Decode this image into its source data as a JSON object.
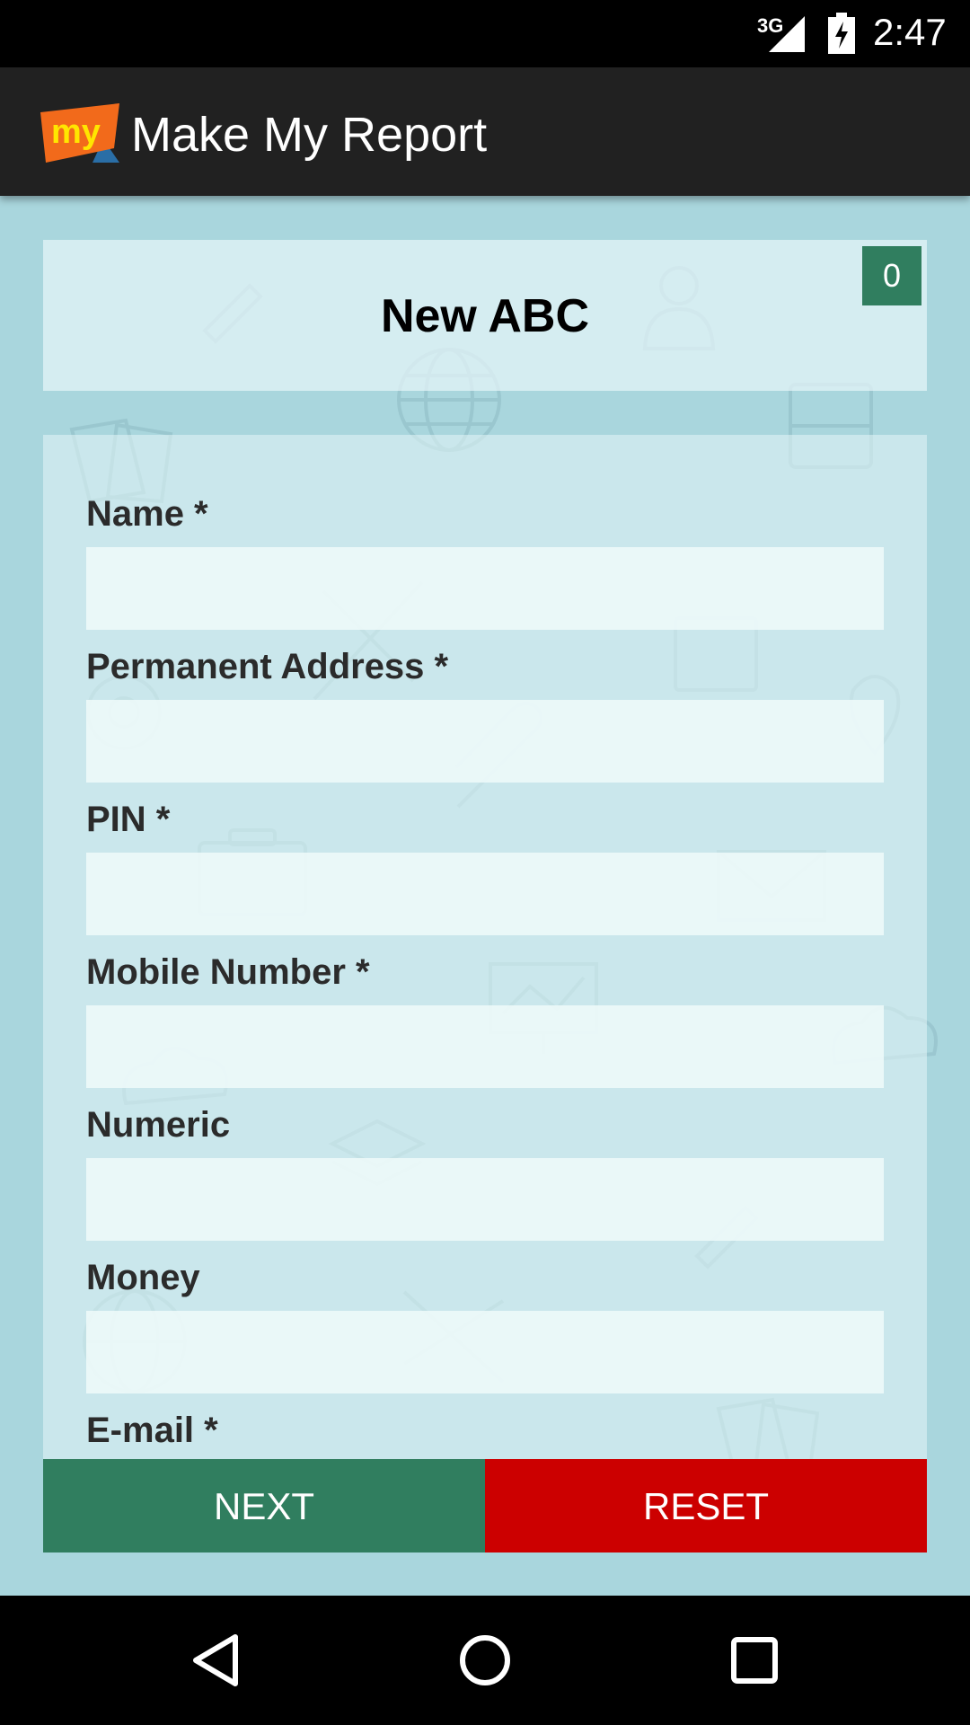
{
  "status_bar": {
    "network": "3G",
    "time": "2:47"
  },
  "app_bar": {
    "logo_text": "my",
    "title": "Make My Report"
  },
  "header": {
    "title": "New ABC",
    "count_badge": "0"
  },
  "form": {
    "fields": [
      {
        "label": "Name *",
        "value": "",
        "placeholder": ""
      },
      {
        "label": "Permanent Address *",
        "value": "",
        "placeholder": ""
      },
      {
        "label": "PIN *",
        "value": "",
        "placeholder": ""
      },
      {
        "label": "Mobile Number *",
        "value": "",
        "placeholder": ""
      },
      {
        "label": "Numeric",
        "value": "",
        "placeholder": ""
      },
      {
        "label": "Money",
        "value": "",
        "placeholder": ""
      },
      {
        "label": "E-mail *",
        "value": "",
        "placeholder": ""
      }
    ]
  },
  "buttons": {
    "next_label": "NEXT",
    "reset_label": "RESET"
  },
  "colors": {
    "background": "#a9d6dd",
    "app_bar": "#212121",
    "primary_green": "#307e5f",
    "reset_red": "#cc0000",
    "logo_orange": "#f26a1b",
    "logo_text_yellow": "#ffe600"
  },
  "icons": {
    "signal": "cell-signal-icon",
    "battery": "battery-charging-icon",
    "back": "back-triangle-icon",
    "home": "home-circle-icon",
    "recent": "recent-square-icon"
  }
}
